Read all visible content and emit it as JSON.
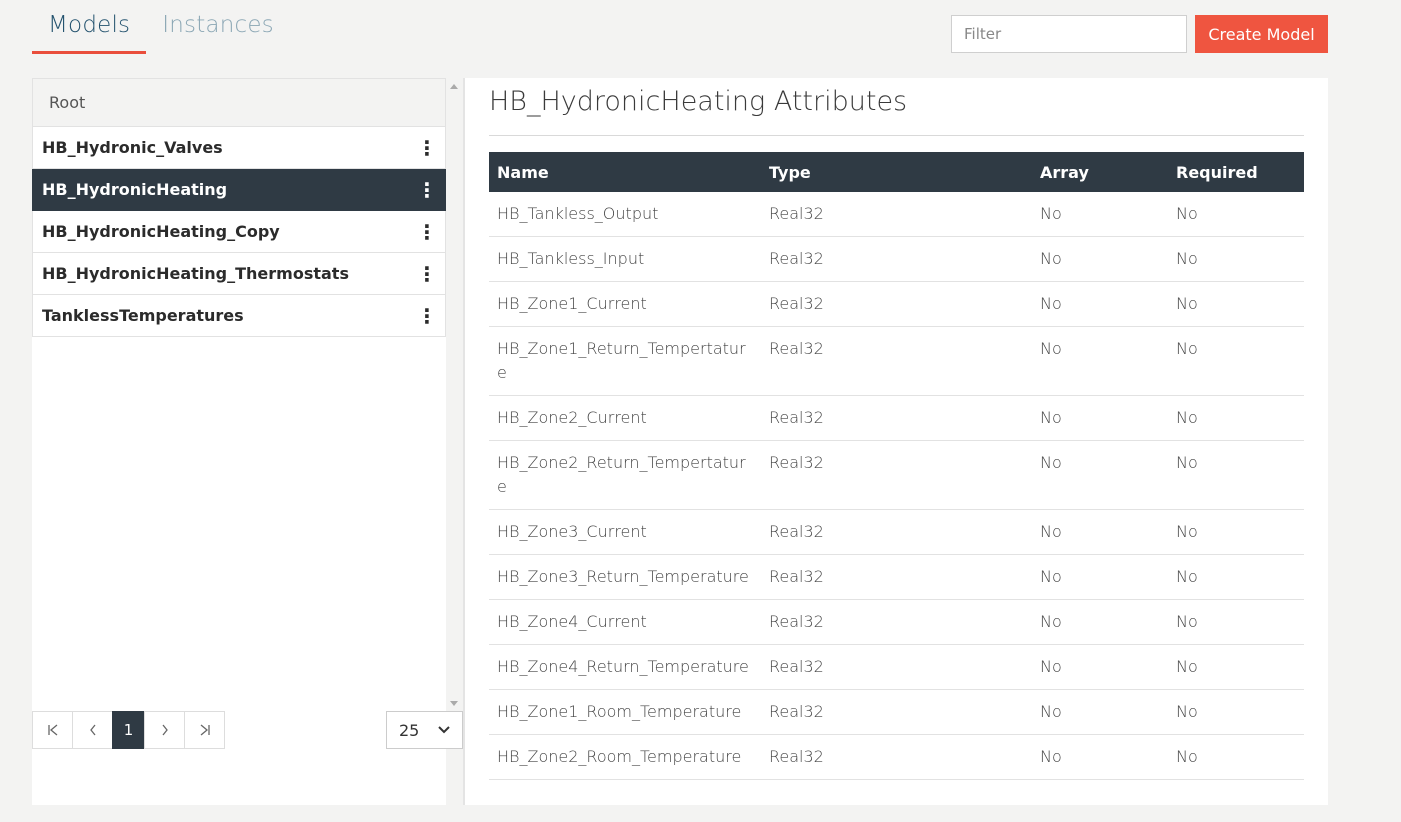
{
  "tabs": [
    {
      "label": "Models",
      "active": true
    },
    {
      "label": "Instances",
      "active": false
    }
  ],
  "filter": {
    "placeholder": "Filter",
    "value": ""
  },
  "create_button": "Create Model",
  "tree": {
    "root_label": "Root",
    "items": [
      {
        "label": "HB_Hydronic_Valves",
        "selected": false
      },
      {
        "label": "HB_HydronicHeating",
        "selected": true
      },
      {
        "label": "HB_HydronicHeating_Copy",
        "selected": false
      },
      {
        "label": "HB_HydronicHeating_Thermostats",
        "selected": false
      },
      {
        "label": "TanklessTemperatures",
        "selected": false
      }
    ]
  },
  "pagination": {
    "first": "⏮",
    "prev": "‹",
    "current": "1",
    "next": "›",
    "last": "⏭",
    "page_size": "25"
  },
  "attributes": {
    "title": "HB_HydronicHeating Attributes",
    "columns": [
      "Name",
      "Type",
      "Array",
      "Required"
    ],
    "rows": [
      [
        "HB_Tankless_Output",
        "Real32",
        "No",
        "No"
      ],
      [
        "HB_Tankless_Input",
        "Real32",
        "No",
        "No"
      ],
      [
        "HB_Zone1_Current",
        "Real32",
        "No",
        "No"
      ],
      [
        "HB_Zone1_Return_Tempertature",
        "Real32",
        "No",
        "No"
      ],
      [
        "HB_Zone2_Current",
        "Real32",
        "No",
        "No"
      ],
      [
        "HB_Zone2_Return_Tempertature",
        "Real32",
        "No",
        "No"
      ],
      [
        "HB_Zone3_Current",
        "Real32",
        "No",
        "No"
      ],
      [
        "HB_Zone3_Return_Temperature",
        "Real32",
        "No",
        "No"
      ],
      [
        "HB_Zone4_Current",
        "Real32",
        "No",
        "No"
      ],
      [
        "HB_Zone4_Return_Temperature",
        "Real32",
        "No",
        "No"
      ],
      [
        "HB_Zone1_Room_Temperature",
        "Real32",
        "No",
        "No"
      ],
      [
        "HB_Zone2_Room_Temperature",
        "Real32",
        "No",
        "No"
      ]
    ]
  }
}
